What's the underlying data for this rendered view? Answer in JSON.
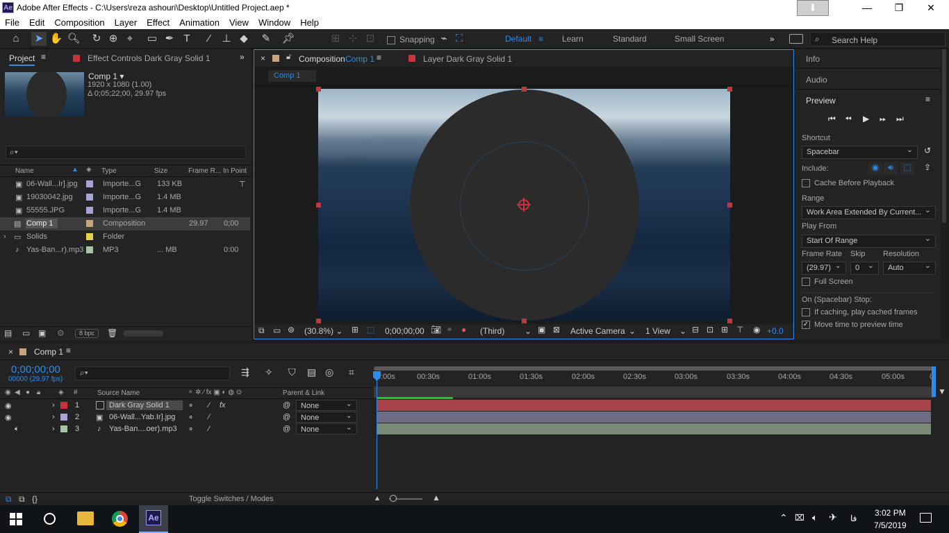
{
  "window": {
    "app_icon": "Ae",
    "title": "Adobe After Effects - C:\\Users\\reza ashouri\\Desktop\\Untitled Project.aep *"
  },
  "menu": [
    "File",
    "Edit",
    "Composition",
    "Layer",
    "Effect",
    "Animation",
    "View",
    "Window",
    "Help"
  ],
  "toolbar": {
    "snapping_label": "Snapping",
    "workspaces": [
      "Default",
      "Learn",
      "Standard",
      "Small Screen"
    ],
    "active_workspace": "Default",
    "search_placeholder": "Search Help"
  },
  "project_panel": {
    "tab_project": "Project",
    "tab_effect_controls": "Effect Controls Dark Gray Solid 1",
    "comp_name": "Comp 1 ▾",
    "comp_size": "1920 x 1080 (1.00)",
    "comp_duration": "Δ 0;05;22;00, 29.97 fps",
    "search_placeholder": "",
    "columns": [
      "Name",
      "Type",
      "Size",
      "Frame R...",
      "In Point"
    ],
    "items": [
      {
        "name": "06-Wall...Ir].jpg",
        "type": "Importe...G",
        "size": "133 KB",
        "fps": "",
        "inpoint": "",
        "color": "#a7a4d6",
        "icon": "image-icon"
      },
      {
        "name": "19030042.jpg",
        "type": "Importe...G",
        "size": "1.4 MB",
        "fps": "",
        "inpoint": "",
        "color": "#a7a4d6",
        "icon": "image-icon"
      },
      {
        "name": "55555.JPG",
        "type": "Importe...G",
        "size": "1.4 MB",
        "fps": "",
        "inpoint": "",
        "color": "#a7a4d6",
        "icon": "image-icon"
      },
      {
        "name": "Comp 1",
        "type": "Composition",
        "size": "",
        "fps": "29.97",
        "inpoint": "0;00",
        "color": "#c9a37a",
        "icon": "composition-icon"
      },
      {
        "name": "Solids",
        "type": "Folder",
        "size": "",
        "fps": "",
        "inpoint": "",
        "color": "#e6d24b",
        "icon": "folder-icon"
      },
      {
        "name": "Yas-Ban...r).mp3",
        "type": "MP3",
        "size": "... MB",
        "fps": "",
        "inpoint": "0:00",
        "color": "#a7c5a4",
        "icon": "audio-icon"
      }
    ],
    "bpc": "8 bpc"
  },
  "comp_panel": {
    "tab_composition": "Composition",
    "tab_comp_name": "Comp 1",
    "tab_layer": "Layer  Dark Gray Solid 1",
    "breadcrumb": "Comp 1",
    "zoom": "(30.8%)",
    "timecode": "0;00;00;00",
    "resolution": "(Third)",
    "camera": "Active Camera",
    "views": "1 View",
    "exposure": "+0.0"
  },
  "right_panel": {
    "info": "Info",
    "audio": "Audio",
    "preview": "Preview",
    "shortcut_label": "Shortcut",
    "shortcut_value": "Spacebar",
    "include_label": "Include:",
    "cache_label": "Cache Before Playback",
    "range_label": "Range",
    "range_value": "Work Area Extended By Current...",
    "play_from_label": "Play From",
    "play_from_value": "Start Of Range",
    "frame_rate_label": "Frame Rate",
    "skip_label": "Skip",
    "resolution_label": "Resolution",
    "frame_rate_value": "(29.97)",
    "skip_value": "0",
    "resolution_value": "Auto",
    "full_screen_label": "Full Screen",
    "stop_label": "On (Spacebar) Stop:",
    "if_caching_label": "If caching, play cached frames",
    "move_time_label": "Move time to preview time"
  },
  "timeline": {
    "tab": "Comp 1",
    "timecode": "0;00;00;00",
    "frames": "00000 (29.97 fps)",
    "search_placeholder": "",
    "col_source_name": "Source Name",
    "col_parent": "Parent & Link",
    "ruler": [
      "0:00s",
      "00:30s",
      "01:00s",
      "01:30s",
      "02:00s",
      "02:30s",
      "03:00s",
      "03:30s",
      "04:00s",
      "04:30s",
      "05:00s",
      "0"
    ],
    "layers": [
      {
        "num": "1",
        "name": "Dark Gray Solid 1",
        "parent": "None",
        "color": "#c8343a",
        "bar": "#a9454a"
      },
      {
        "num": "2",
        "name": "06-Wall...Yab.Ir].jpg",
        "parent": "None",
        "color": "#a7a4d6",
        "bar": "#6e6c84"
      },
      {
        "num": "3",
        "name": "Yas-Ban....oer).mp3",
        "parent": "None",
        "color": "#a7c5a4",
        "bar": "#7a8a79"
      }
    ],
    "toggle_label": "Toggle Switches / Modes"
  },
  "taskbar": {
    "lang": "فا",
    "time": "3:02 PM",
    "date": "7/5/2019"
  },
  "colors": {
    "accent": "#2d8ceb",
    "panel": "#232323",
    "bg": "#1d1d1d",
    "timecode": "#2d8ceb"
  }
}
